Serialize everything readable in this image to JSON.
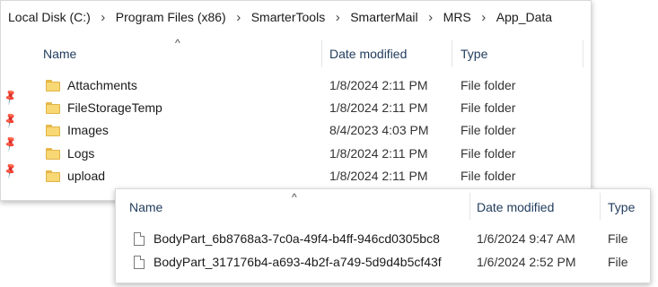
{
  "breadcrumb": [
    "Local Disk (C:)",
    "Program Files (x86)",
    "SmarterTools",
    "SmarterMail",
    "MRS",
    "App_Data"
  ],
  "breadcrumb_separator": "›",
  "sort_caret": "^",
  "pin_glyph": "📌",
  "window1": {
    "columns": {
      "name": "Name",
      "date": "Date modified",
      "type": "Type"
    },
    "rows": [
      {
        "name": "Attachments",
        "date": "1/8/2024 2:11 PM",
        "type": "File folder"
      },
      {
        "name": "FileStorageTemp",
        "date": "1/8/2024 2:11 PM",
        "type": "File folder"
      },
      {
        "name": "Images",
        "date": "8/4/2023 4:03 PM",
        "type": "File folder"
      },
      {
        "name": "Logs",
        "date": "1/8/2024 2:11 PM",
        "type": "File folder"
      },
      {
        "name": "upload",
        "date": "1/8/2024 2:11 PM",
        "type": "File folder"
      }
    ]
  },
  "window2": {
    "columns": {
      "name": "Name",
      "date": "Date modified",
      "type": "Type"
    },
    "rows": [
      {
        "name": "BodyPart_6b8768a3-7c0a-49f4-b4ff-946cd0305bc8",
        "date": "1/6/2024 9:47 AM",
        "type": "File"
      },
      {
        "name": "BodyPart_317176b4-a693-4b2f-a749-5d9d4b5cf43f",
        "date": "1/6/2024 2:52 PM",
        "type": "File"
      }
    ]
  },
  "colors": {
    "folder_fill": "#f8d775",
    "folder_edge": "#e0b445",
    "header_text": "#1f3b5c"
  }
}
